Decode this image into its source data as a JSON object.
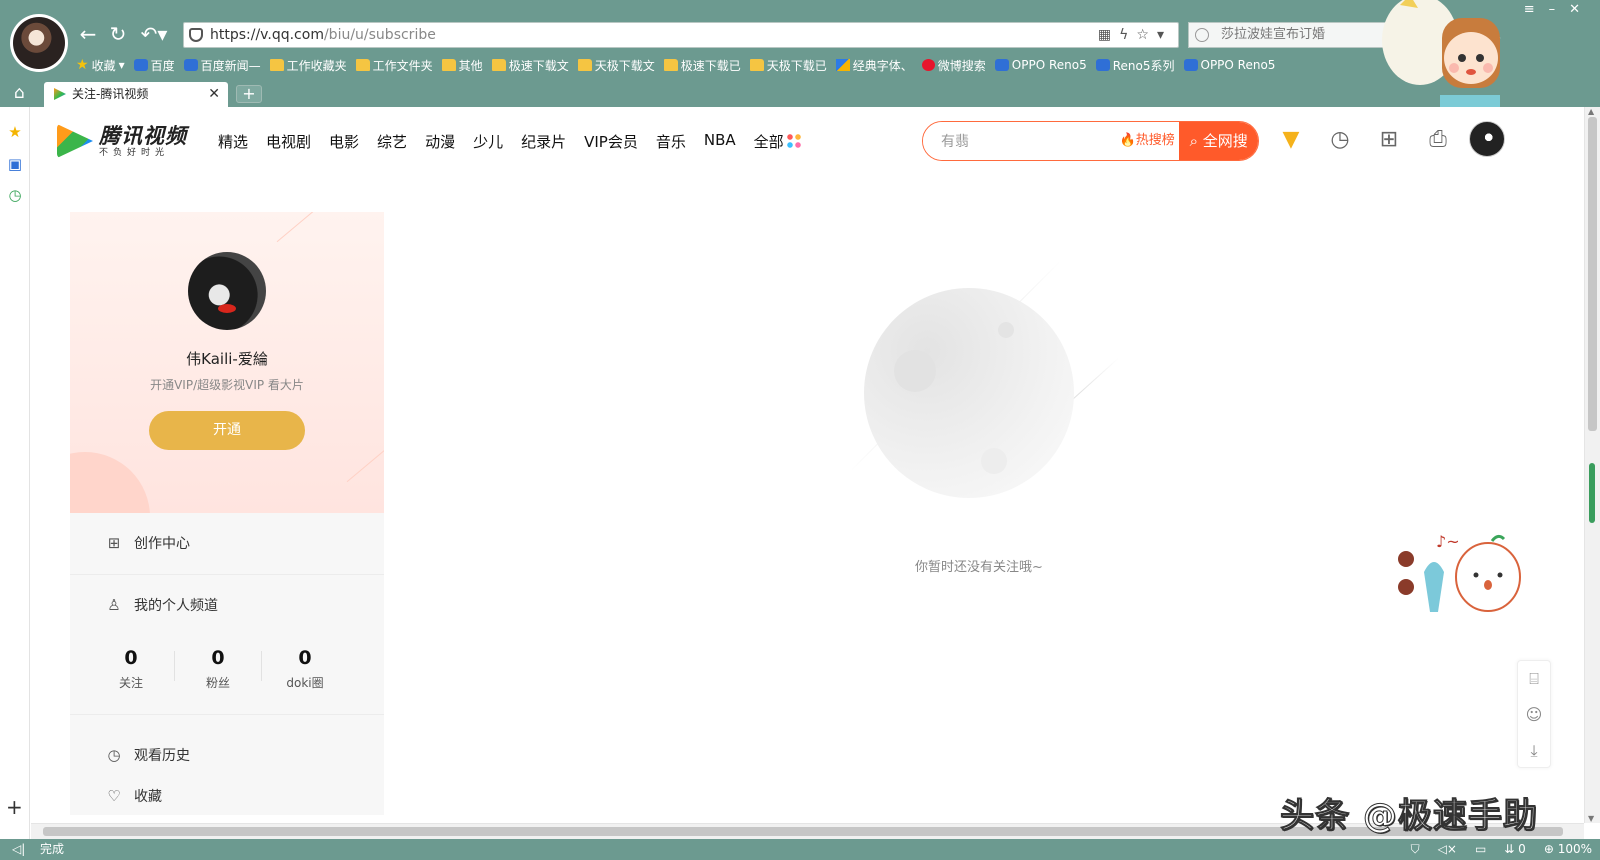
{
  "browser": {
    "url_host": "https://v.qq.com",
    "url_path": "/biu/u/subscribe",
    "search_placeholder": "莎拉波娃宣布订婚",
    "tab_title": "关注-腾讯视频",
    "new_tab_label": "+",
    "status_text": "完成",
    "status_right": [
      "0",
      "100%"
    ]
  },
  "bookmarks": [
    {
      "label": "收藏",
      "icon": "star"
    },
    {
      "label": "百度",
      "icon": "paw"
    },
    {
      "label": "百度新闻—",
      "icon": "paw"
    },
    {
      "label": "工作收藏夹",
      "icon": "folder"
    },
    {
      "label": "工作文件夹",
      "icon": "folder"
    },
    {
      "label": "其他",
      "icon": "folder"
    },
    {
      "label": "极速下载文",
      "icon": "folder"
    },
    {
      "label": "天极下载文",
      "icon": "folder"
    },
    {
      "label": "极速下载已",
      "icon": "folder"
    },
    {
      "label": "天极下载已",
      "icon": "folder"
    },
    {
      "label": "经典字体、",
      "icon": "ziti"
    },
    {
      "label": "微博搜索",
      "icon": "weibo"
    },
    {
      "label": "OPPO Reno5",
      "icon": "paw"
    },
    {
      "label": "Reno5系列",
      "icon": "paw"
    },
    {
      "label": "OPPO Reno5",
      "icon": "paw"
    }
  ],
  "site": {
    "logo_name": "腾讯视频",
    "logo_slogan": "不负好时光",
    "channels": [
      "精选",
      "电视剧",
      "电影",
      "综艺",
      "动漫",
      "少儿",
      "纪录片",
      "VIP会员",
      "音乐",
      "NBA",
      "全部"
    ],
    "search_value": "有翡",
    "hot_label": "热搜榜",
    "search_button": "全网搜"
  },
  "profile": {
    "username": "伟Kaili-爱綸",
    "vip_hint": "开通VIP/超级影视VIP 看大片",
    "open_button": "开通",
    "menu": {
      "creator": "创作中心",
      "channel": "我的个人频道",
      "history": "观看历史",
      "favorites": "收藏"
    },
    "stats": [
      {
        "value": "0",
        "label": "关注"
      },
      {
        "value": "0",
        "label": "粉丝"
      },
      {
        "value": "0",
        "label": "doki圈"
      }
    ]
  },
  "empty_state": {
    "message": "你暂时还没有关注哦~"
  },
  "watermark": "头条 @极速手助"
}
